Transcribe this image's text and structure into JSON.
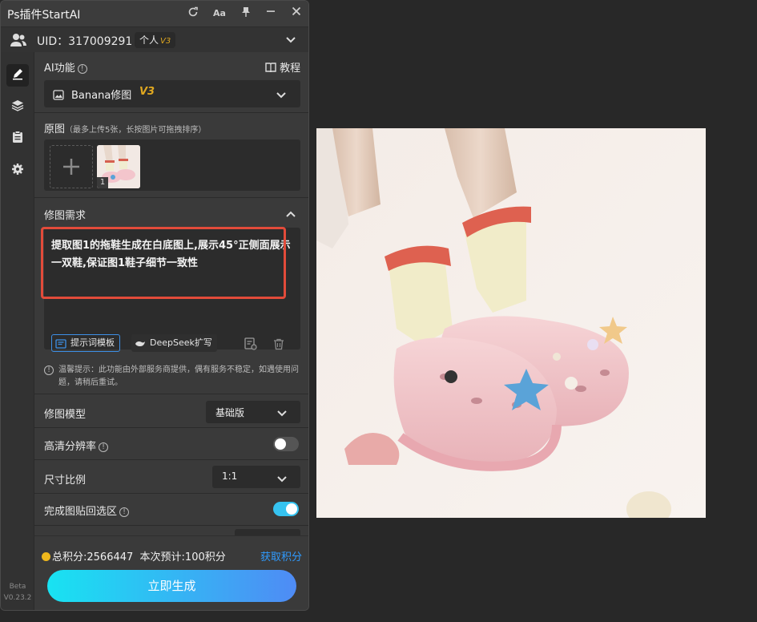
{
  "window": {
    "title": "Ps插件StartAI",
    "icons": [
      "refresh-icon",
      "font-size-icon",
      "pin-icon",
      "minimize-icon",
      "close-icon"
    ]
  },
  "account": {
    "uid_text": "UID：317009291",
    "plan_label": "个人",
    "plan_tier": "V3"
  },
  "sidebar": {
    "items": [
      "pen-icon",
      "layers-icon",
      "clipboard-icon",
      "gear-icon"
    ],
    "beta_label": "Beta",
    "version": "V0.23.2"
  },
  "ai_function": {
    "label": "AI功能",
    "tutorial_label": "教程",
    "selected_name": "Banana修图",
    "selected_tier": "V3"
  },
  "source_images": {
    "label": "原图",
    "hint": "（最多上传5张，长按图片可拖拽排序）",
    "thumbnails": [
      {
        "index": "1"
      }
    ]
  },
  "edit_request": {
    "label": "修图需求",
    "prompt": "提取图1的拖鞋生成在白底图上,展示45°正侧面展示一双鞋,保证图1鞋子细节一致性",
    "template_button": "提示词模板",
    "deepseek_button": "DeepSeek扩写"
  },
  "notice": "温馨提示：此功能由外部服务商提供，偶有服务不稳定，如遇使用问题，请稍后重试。",
  "settings": {
    "model_label": "修图模型",
    "model_value": "基础版",
    "hd_label": "高清分辨率",
    "hd_enabled": false,
    "ratio_label": "尺寸比例",
    "ratio_value": "1:1",
    "paste_label": "完成图贴回选区",
    "paste_enabled": true
  },
  "footer": {
    "points_text": "总积分:2566447  本次预计:100积分",
    "get_points": "获取积分",
    "generate_button": "立即生成"
  },
  "colors": {
    "accent_blue": "#2f9bff",
    "toggle_on": "#36c3f0",
    "highlight_red": "#e24b3a",
    "tier_gold": "#e0a820",
    "gradient_start": "#18e3f2",
    "gradient_end": "#4f8bf5"
  }
}
